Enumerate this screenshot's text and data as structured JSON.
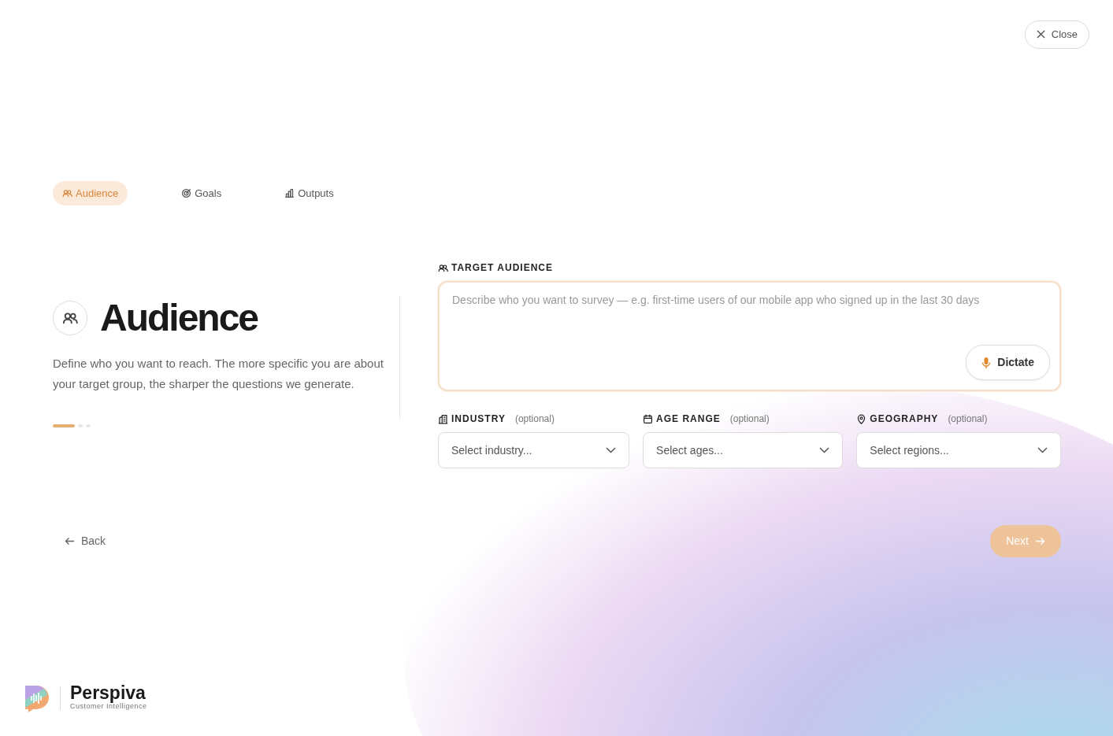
{
  "close_button": {
    "label": "Close"
  },
  "tabs": [
    {
      "label": "Audience",
      "kind": "people",
      "selected": true
    },
    {
      "label": "Goals",
      "kind": "target",
      "selected": false
    },
    {
      "label": "Outputs",
      "kind": "chart",
      "selected": false
    }
  ],
  "intro": {
    "title": "Audience",
    "description": "Define who you want to reach. The more specific you are about your target group, the sharper the questions we generate.",
    "steps": [
      {
        "selected": true
      },
      {
        "selected": false
      },
      {
        "selected": false
      }
    ]
  },
  "target_audience": {
    "label": "TARGET AUDIENCE",
    "placeholder": "Describe who you want to survey — e.g. first-time users of our mobile app who signed up in the last 30 days",
    "dictate_button": "Dictate"
  },
  "filters": [
    {
      "kind": "building",
      "label": "INDUSTRY",
      "note": "(optional)",
      "placeholder": "Select industry..."
    },
    {
      "kind": "calendar",
      "label": "AGE RANGE",
      "note": "(optional)",
      "placeholder": "Select ages..."
    },
    {
      "kind": "pin",
      "label": "GEOGRAPHY",
      "note": "(optional)",
      "placeholder": "Select regions..."
    }
  ],
  "back_button": {
    "label": "Back"
  },
  "next_button": {
    "label": "Next",
    "disabled": true
  },
  "brand": {
    "name": "Perspiva",
    "tagline": "Customer Intelligence"
  }
}
